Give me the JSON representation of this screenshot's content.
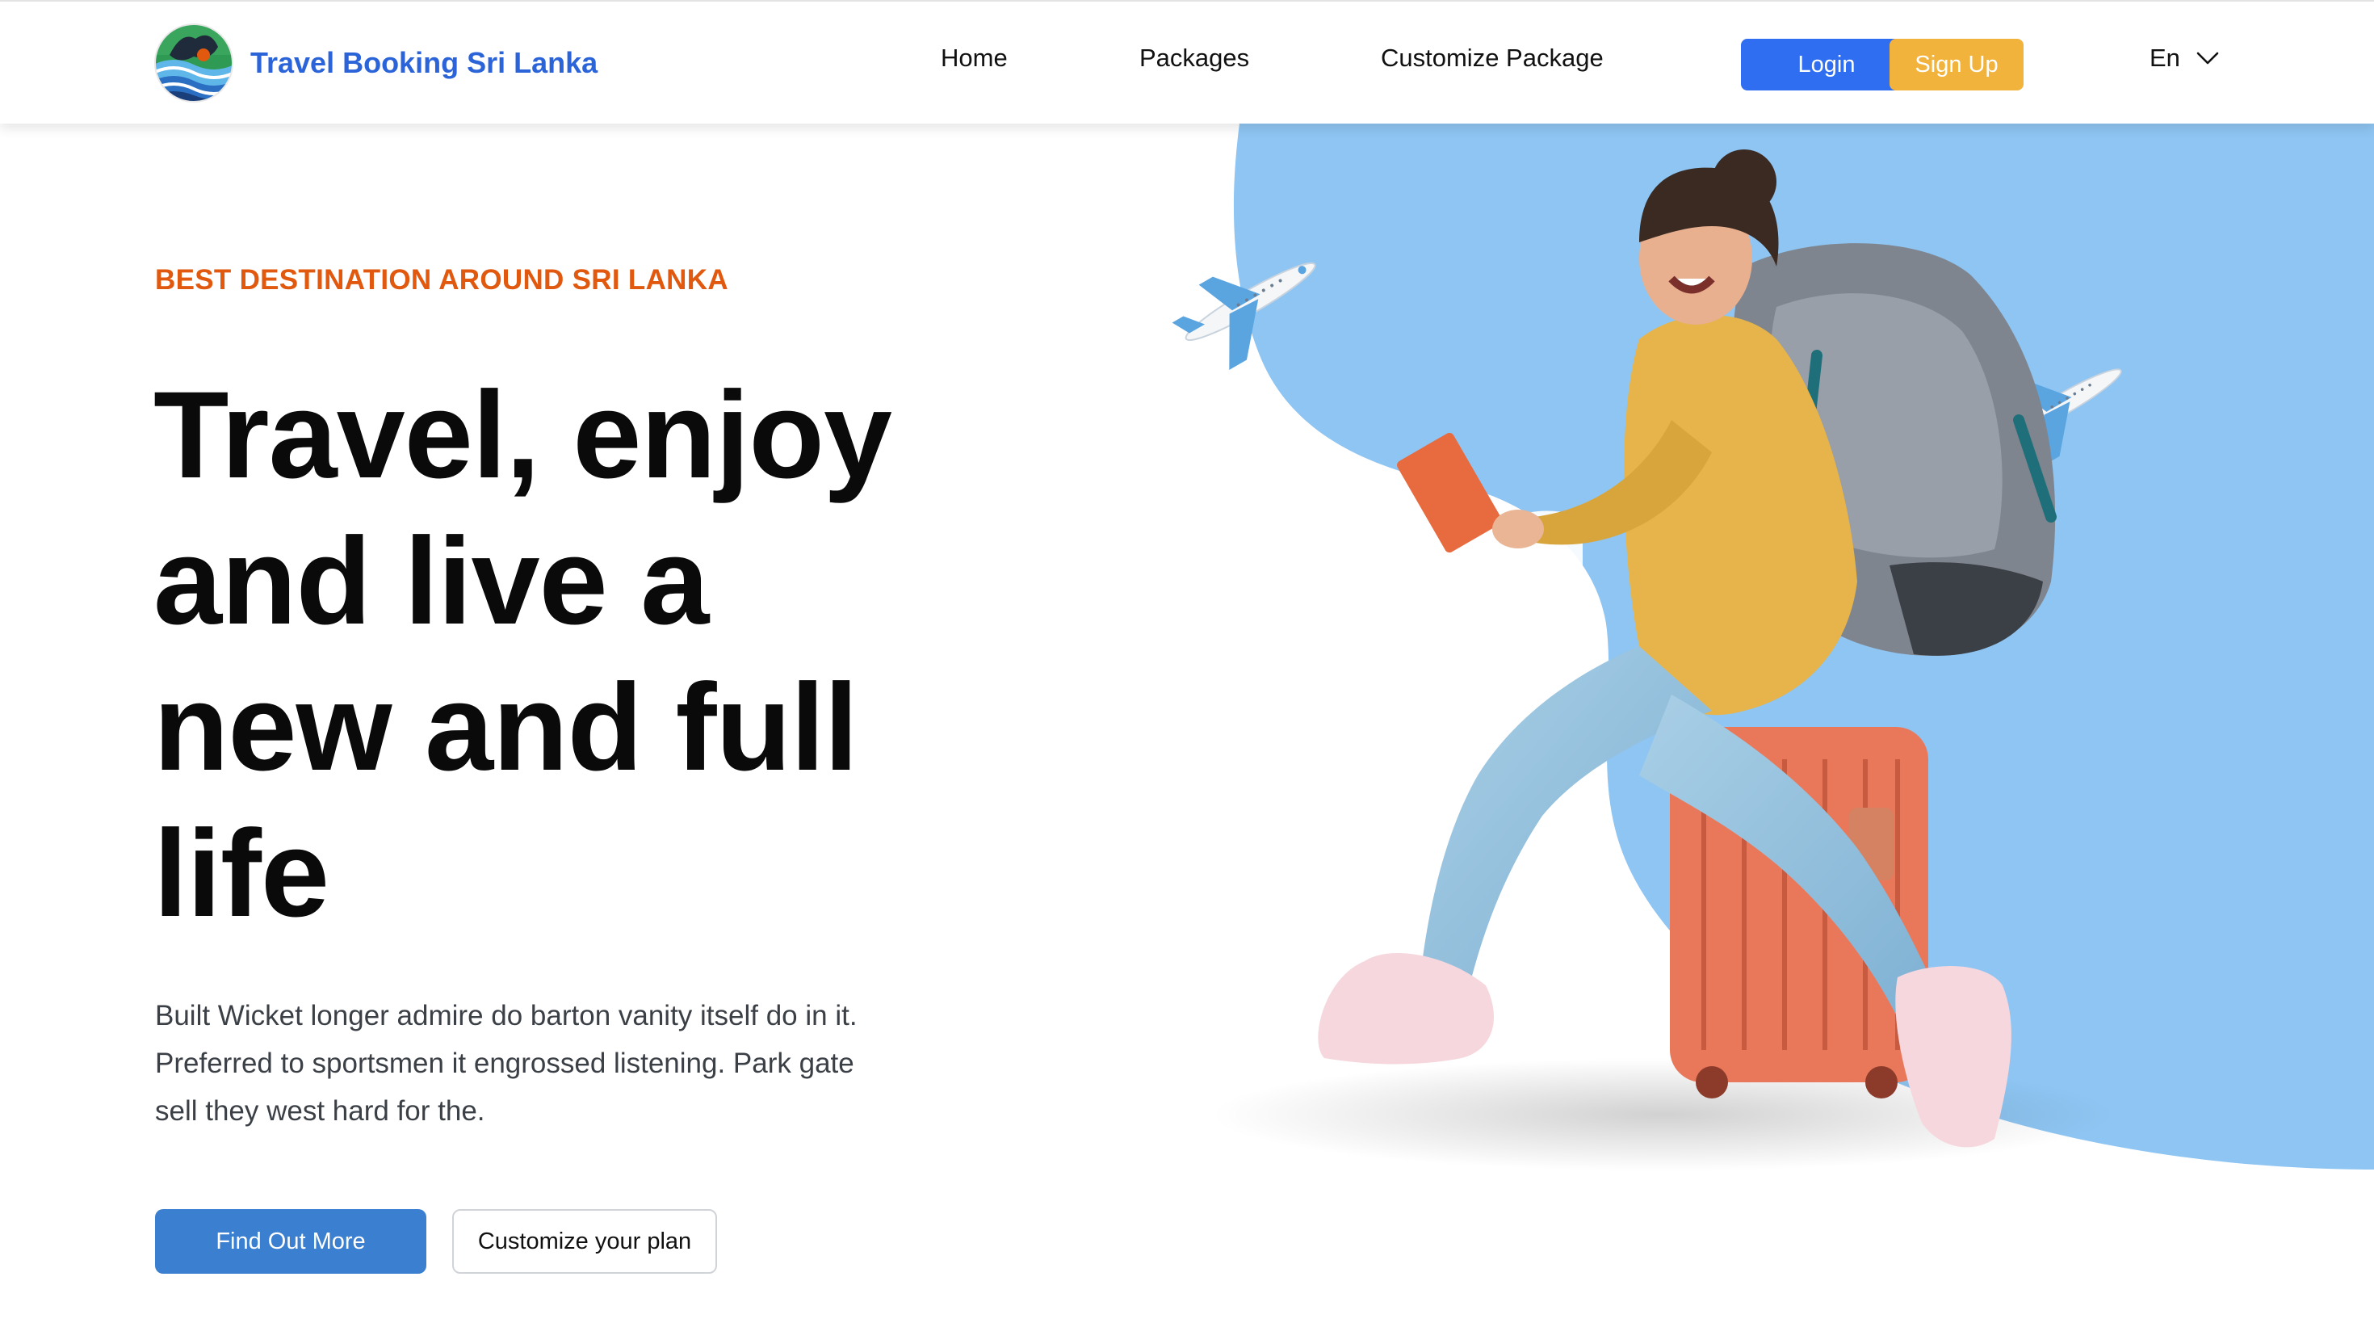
{
  "nav": {
    "brand": "Travel Booking Sri Lanka",
    "links": [
      "Home",
      "Packages",
      "Customize Package"
    ],
    "login_label": "Login",
    "signup_label": "Sign Up",
    "language": "En"
  },
  "hero": {
    "eyebrow": "BEST DESTINATION AROUND SRI LANKA",
    "headline_lines": [
      "Travel, enjoy",
      "and live a",
      "new and full",
      "life"
    ],
    "description": "Built Wicket longer admire do barton vanity itself do in it. Preferred to sportsmen it engrossed listening. Park gate sell they west hard for the.",
    "primary_button": "Find Out More",
    "secondary_button": "Customize your plan"
  },
  "colors": {
    "brand_blue": "#2b63d9",
    "login_blue": "#2f6ef0",
    "signup_yellow": "#f1b33b",
    "eyebrow_orange": "#e1580f",
    "primary_button": "#3b7fd0",
    "hero_blob": "#8ec5f2"
  },
  "icons": {
    "logo": "sri-lanka-waves-logo",
    "language": "chevron-down-icon",
    "decor": [
      "airplane-icon",
      "airplane-icon"
    ]
  }
}
